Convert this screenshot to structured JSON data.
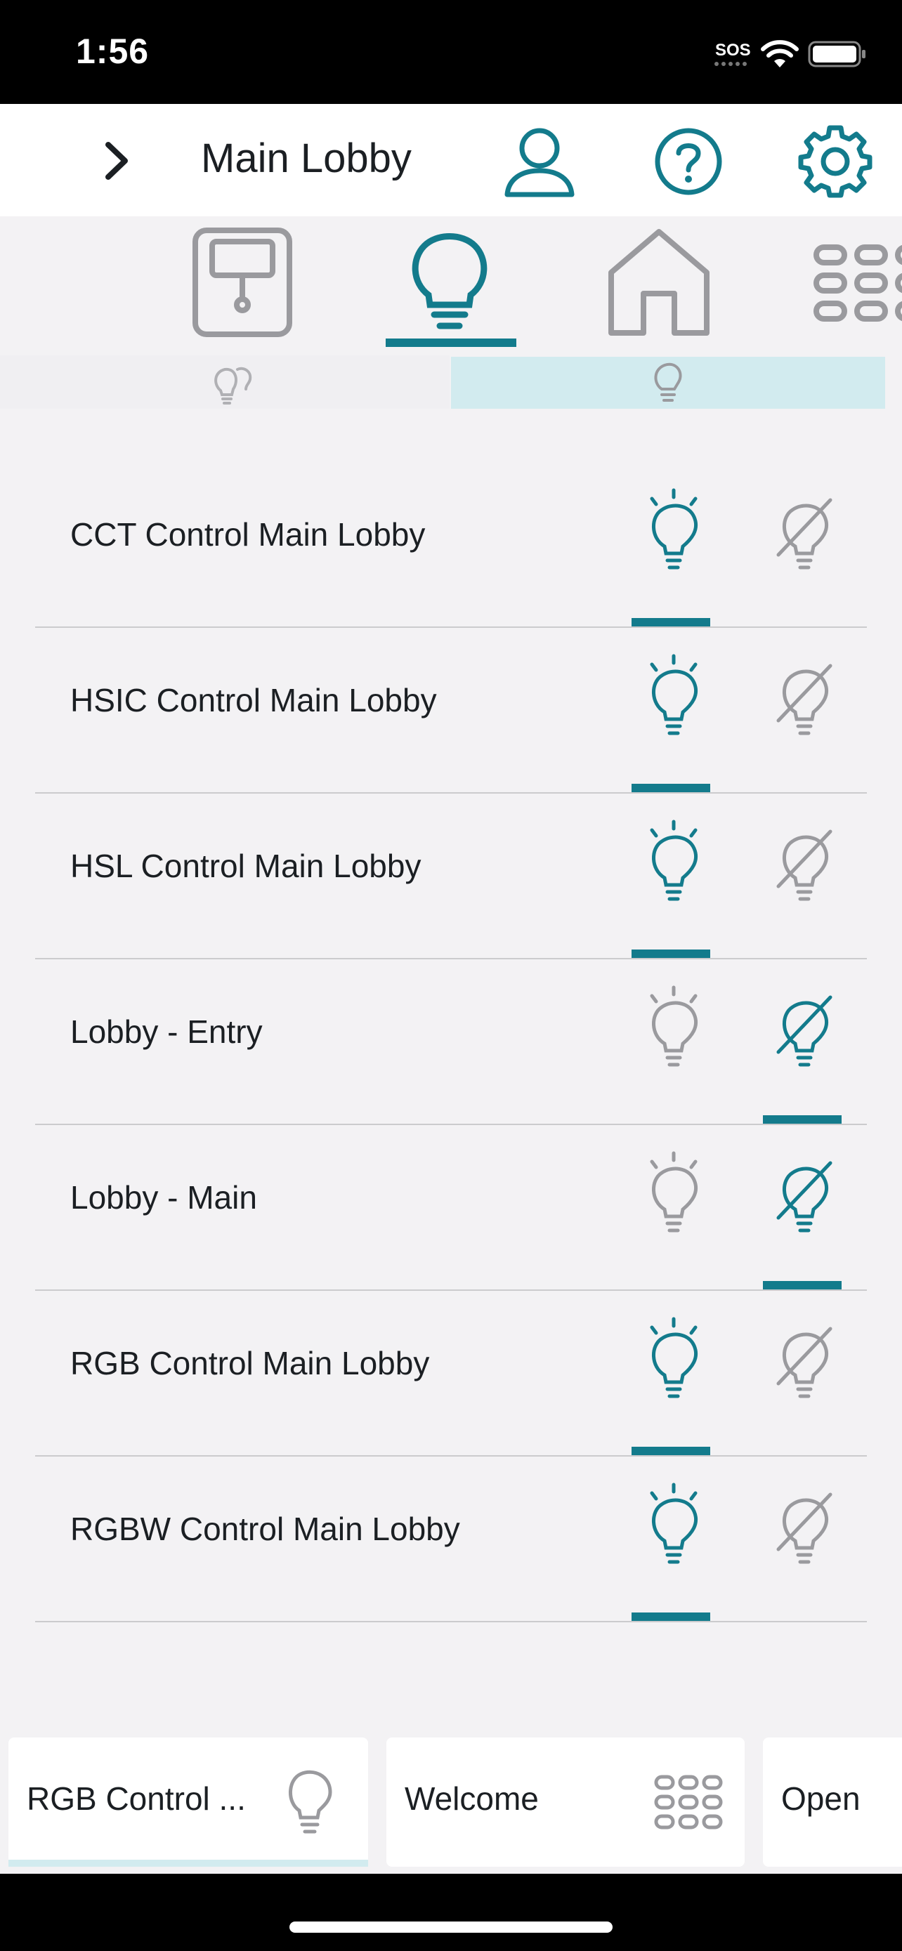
{
  "status_bar": {
    "time": "1:56",
    "sos": "SOS",
    "icons": [
      "wifi-icon",
      "battery-icon"
    ]
  },
  "header": {
    "title": "Main Lobby",
    "icons": [
      "chevron-right-icon",
      "user-icon",
      "help-icon",
      "gear-icon"
    ]
  },
  "category_tabs": [
    {
      "icon": "door-icon",
      "selected": false
    },
    {
      "icon": "lightbulb-icon",
      "selected": true
    },
    {
      "icon": "home-icon",
      "selected": false
    },
    {
      "icon": "keypad-icon",
      "selected": false
    }
  ],
  "sub_tabs": [
    {
      "icon": "multi-bulb-icon",
      "selected": false
    },
    {
      "icon": "single-bulb-icon",
      "selected": true
    }
  ],
  "loads": [
    {
      "label": "CCT Control Main Lobby",
      "state": "on"
    },
    {
      "label": "HSIC Control Main Lobby",
      "state": "on"
    },
    {
      "label": "HSL Control Main Lobby",
      "state": "on"
    },
    {
      "label": "Lobby - Entry",
      "state": "off"
    },
    {
      "label": "Lobby - Main",
      "state": "off"
    },
    {
      "label": "RGB Control Main Lobby",
      "state": "on"
    },
    {
      "label": "RGBW Control Main Lobby",
      "state": "on"
    }
  ],
  "bottom_cards": [
    {
      "label": "RGB Control ...",
      "icon": "lightbulb-icon",
      "selected": true
    },
    {
      "label": "Welcome",
      "icon": "keypad-icon",
      "selected": false
    },
    {
      "label": "Open",
      "icon": "",
      "selected": false
    }
  ],
  "colors": {
    "accent": "#137b8c",
    "inactive": "#9a9a9e",
    "selected_bg": "#d2ebef",
    "background": "#f3f2f4"
  }
}
